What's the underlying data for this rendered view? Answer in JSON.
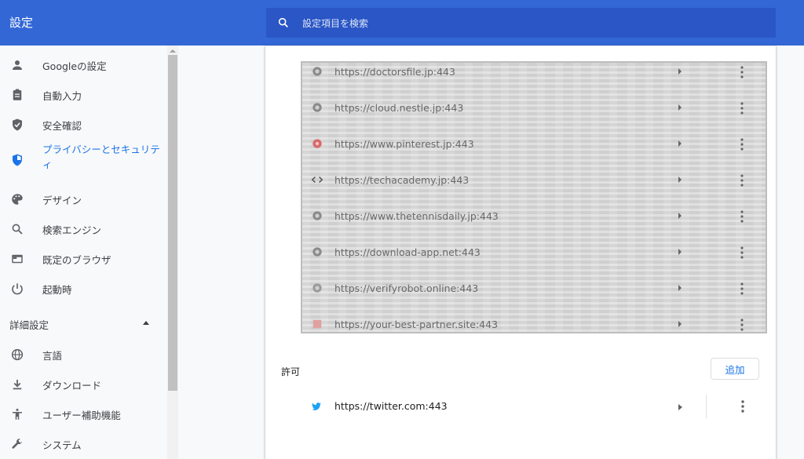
{
  "header": {
    "title": "設定",
    "search_placeholder": "設定項目を検索"
  },
  "sidebar": {
    "items": [
      {
        "label": "Googleの設定",
        "icon": "person-icon"
      },
      {
        "label": "自動入力",
        "icon": "clipboard-icon"
      },
      {
        "label": "安全確認",
        "icon": "shield-check-icon"
      },
      {
        "label": "プライバシーとセキュリティ",
        "icon": "shield-icon",
        "active": true
      },
      {
        "label": "デザイン",
        "icon": "palette-icon"
      },
      {
        "label": "検索エンジン",
        "icon": "search-icon"
      },
      {
        "label": "既定のブラウザ",
        "icon": "browser-icon"
      },
      {
        "label": "起動時",
        "icon": "power-icon"
      }
    ],
    "advanced_label": "詳細設定",
    "advanced_items": [
      {
        "label": "言語",
        "icon": "globe-icon"
      },
      {
        "label": "ダウンロード",
        "icon": "download-icon"
      },
      {
        "label": "ユーザー補助機能",
        "icon": "accessibility-icon"
      },
      {
        "label": "システム",
        "icon": "wrench-icon"
      }
    ]
  },
  "blocked_sites": [
    {
      "url": "https://doctorsfile.jp:443",
      "icon": "globe-icon"
    },
    {
      "url": "https://cloud.nestle.jp:443",
      "icon": "globe-icon"
    },
    {
      "url": "https://www.pinterest.jp:443",
      "icon": "pinterest-icon"
    },
    {
      "url": "https://techacademy.jp:443",
      "icon": "code-icon"
    },
    {
      "url": "https://www.thetennisdaily.jp:443",
      "icon": "globe-icon"
    },
    {
      "url": "https://download-app.net:443",
      "icon": "globe-icon"
    },
    {
      "url": "https://verifyrobot.online:443",
      "icon": "globe-icon"
    },
    {
      "url": "https://your-best-partner.site:443",
      "icon": "globe-icon"
    }
  ],
  "allow": {
    "label": "許可",
    "add_label": "追加",
    "sites": [
      {
        "url": "https://twitter.com:443",
        "icon": "twitter-icon"
      }
    ]
  },
  "colors": {
    "header_bg": "#3367d6",
    "search_bg": "#2a56c6",
    "accent": "#1a73e8"
  }
}
